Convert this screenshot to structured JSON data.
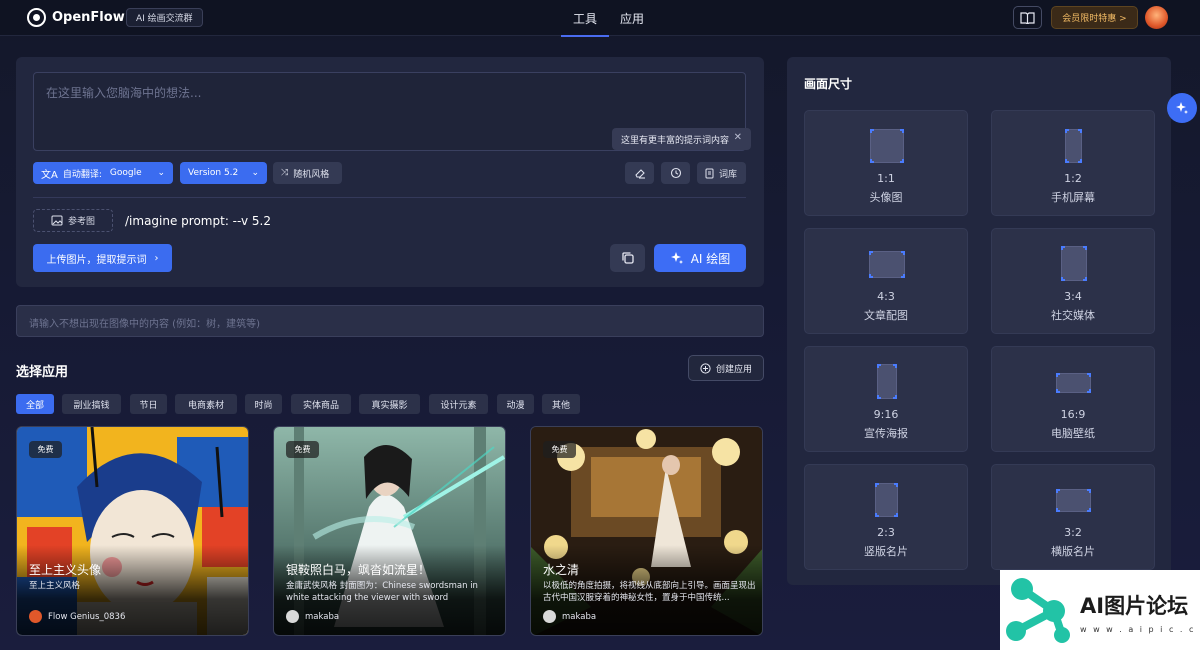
{
  "header": {
    "logo_text": "OpenFlow",
    "group_button": "AI 绘画交流群",
    "tabs": [
      {
        "label": "工具",
        "active": true
      },
      {
        "label": "应用",
        "active": false
      }
    ],
    "vip_button": "会员限时特惠 >",
    "book_icon": "book-icon"
  },
  "prompt": {
    "placeholder": "在这里输入您脑海中的想法...",
    "tooltip": "这里有更丰富的提示词内容",
    "translate_label": "自动翻译:",
    "translate_value": "Google",
    "version_label": "Version 5.2",
    "random_style": "随机风格",
    "library_button": "词库",
    "reference_button": "参考图",
    "command_text": "/imagine prompt:  --v 5.2",
    "upload_button": "上传图片，提取提示词",
    "draw_button": "AI 绘图"
  },
  "negative": {
    "placeholder": "请输入不想出现在图像中的内容 (例如：树，建筑等)"
  },
  "apps": {
    "title": "选择应用",
    "create_button": "创建应用",
    "categories": [
      "全部",
      "副业搞钱",
      "节日",
      "电商素材",
      "时尚",
      "实体商品",
      "真实摄影",
      "设计元素",
      "动漫",
      "其他"
    ],
    "active_category": "全部",
    "cards": [
      {
        "badge": "免费",
        "title": "至上主义头像",
        "desc": "至上主义风格",
        "author": "Flow Genius_0836"
      },
      {
        "badge": "免费",
        "title": "银鞍照白马，飒沓如流星！",
        "desc": "金庸武侠风格 封面图为：Chinese swordsman in white attacking the viewer with sword",
        "author": "makaba"
      },
      {
        "badge": "免费",
        "title": "水之清",
        "desc": "以极低的角度拍摄，将视线从底部向上引导。画面呈现出古代中国汉服穿着的神秘女性，置身于中国传统...",
        "author": "makaba"
      }
    ]
  },
  "size": {
    "title": "画面尺寸",
    "options": [
      {
        "ratio": "1:1",
        "name": "头像图"
      },
      {
        "ratio": "1:2",
        "name": "手机屏幕"
      },
      {
        "ratio": "4:3",
        "name": "文章配图"
      },
      {
        "ratio": "3:4",
        "name": "社交媒体"
      },
      {
        "ratio": "9:16",
        "name": "宣传海报"
      },
      {
        "ratio": "16:9",
        "name": "电脑壁纸"
      },
      {
        "ratio": "2:3",
        "name": "竖版名片"
      },
      {
        "ratio": "3:2",
        "name": "横版名片"
      }
    ]
  },
  "watermark": {
    "text": "AI图片论坛",
    "url": "w w w . a i p i c . c c"
  },
  "colors": {
    "accent": "#3b6cf0",
    "panel": "#22273f",
    "vip": "#f0b964"
  }
}
